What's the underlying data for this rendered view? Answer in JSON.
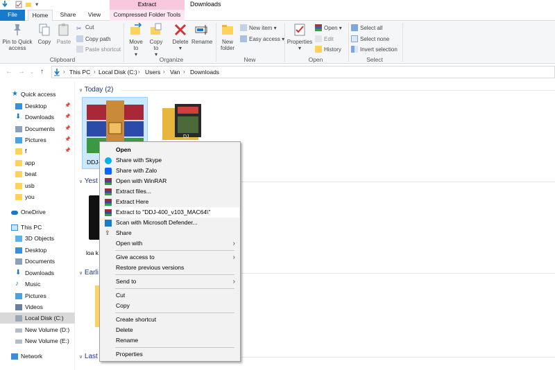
{
  "titlebar": {
    "context_tab_label": "Extract",
    "window_title": "Downloads"
  },
  "tabs": {
    "file": "File",
    "home": "Home",
    "share": "Share",
    "view": "View",
    "compressed": "Compressed Folder Tools"
  },
  "ribbon": {
    "clipboard": {
      "pin": "Pin to Quick access",
      "copy": "Copy",
      "paste": "Paste",
      "cut": "Cut",
      "copy_path": "Copy path",
      "paste_shortcut": "Paste shortcut",
      "label": "Clipboard"
    },
    "organize": {
      "move_to": "Move to",
      "copy_to": "Copy to",
      "delete": "Delete",
      "rename": "Rename",
      "label": "Organize"
    },
    "new": {
      "new_folder": "New folder",
      "new_item": "New item",
      "easy_access": "Easy access",
      "label": "New"
    },
    "open": {
      "properties": "Properties",
      "open": "Open",
      "edit": "Edit",
      "history": "History",
      "label": "Open"
    },
    "select": {
      "select_all": "Select all",
      "select_none": "Select none",
      "invert": "Invert selection",
      "label": "Select"
    }
  },
  "address": {
    "crumbs": [
      "This PC",
      "Local Disk (C:)",
      "Users",
      "Van",
      "Downloads"
    ]
  },
  "nav": {
    "quick_access": "Quick access",
    "quick_items": [
      "Desktop",
      "Downloads",
      "Documents",
      "Pictures",
      "f",
      "app",
      "beat",
      "usb",
      "you"
    ],
    "onedrive": "OneDrive",
    "this_pc": "This PC",
    "pc_items": [
      "3D Objects",
      "Desktop",
      "Documents",
      "Downloads",
      "Music",
      "Pictures",
      "Videos",
      "Local Disk (C:)",
      "New Volume (D:)",
      "New Volume (E:)"
    ],
    "network": "Network"
  },
  "content": {
    "group_today": "Today (2)",
    "group_yesterday": "Yest",
    "group_earlier": "Earli",
    "group_last": "Last",
    "file1_label": "DDJ-",
    "file2_label": "DJ",
    "file3_label": "loa k"
  },
  "context_menu": {
    "open": "Open",
    "skype": "Share with Skype",
    "zalo": "Share with Zalo",
    "winrar": "Open with WinRAR",
    "extract_files": "Extract files...",
    "extract_here": "Extract Here",
    "extract_to": "Extract to \"DDJ-400_v103_MAC64\\\"",
    "defender": "Scan with Microsoft Defender...",
    "share": "Share",
    "open_with": "Open with",
    "give_access": "Give access to",
    "restore": "Restore previous versions",
    "send_to": "Send to",
    "cut": "Cut",
    "copy": "Copy",
    "create_shortcut": "Create shortcut",
    "delete": "Delete",
    "rename": "Rename",
    "properties": "Properties"
  },
  "colors": {
    "accent": "#1979ca",
    "context_tab": "#f7c8df",
    "folder": "#ffd25c",
    "hover": "#e5f3ff"
  }
}
